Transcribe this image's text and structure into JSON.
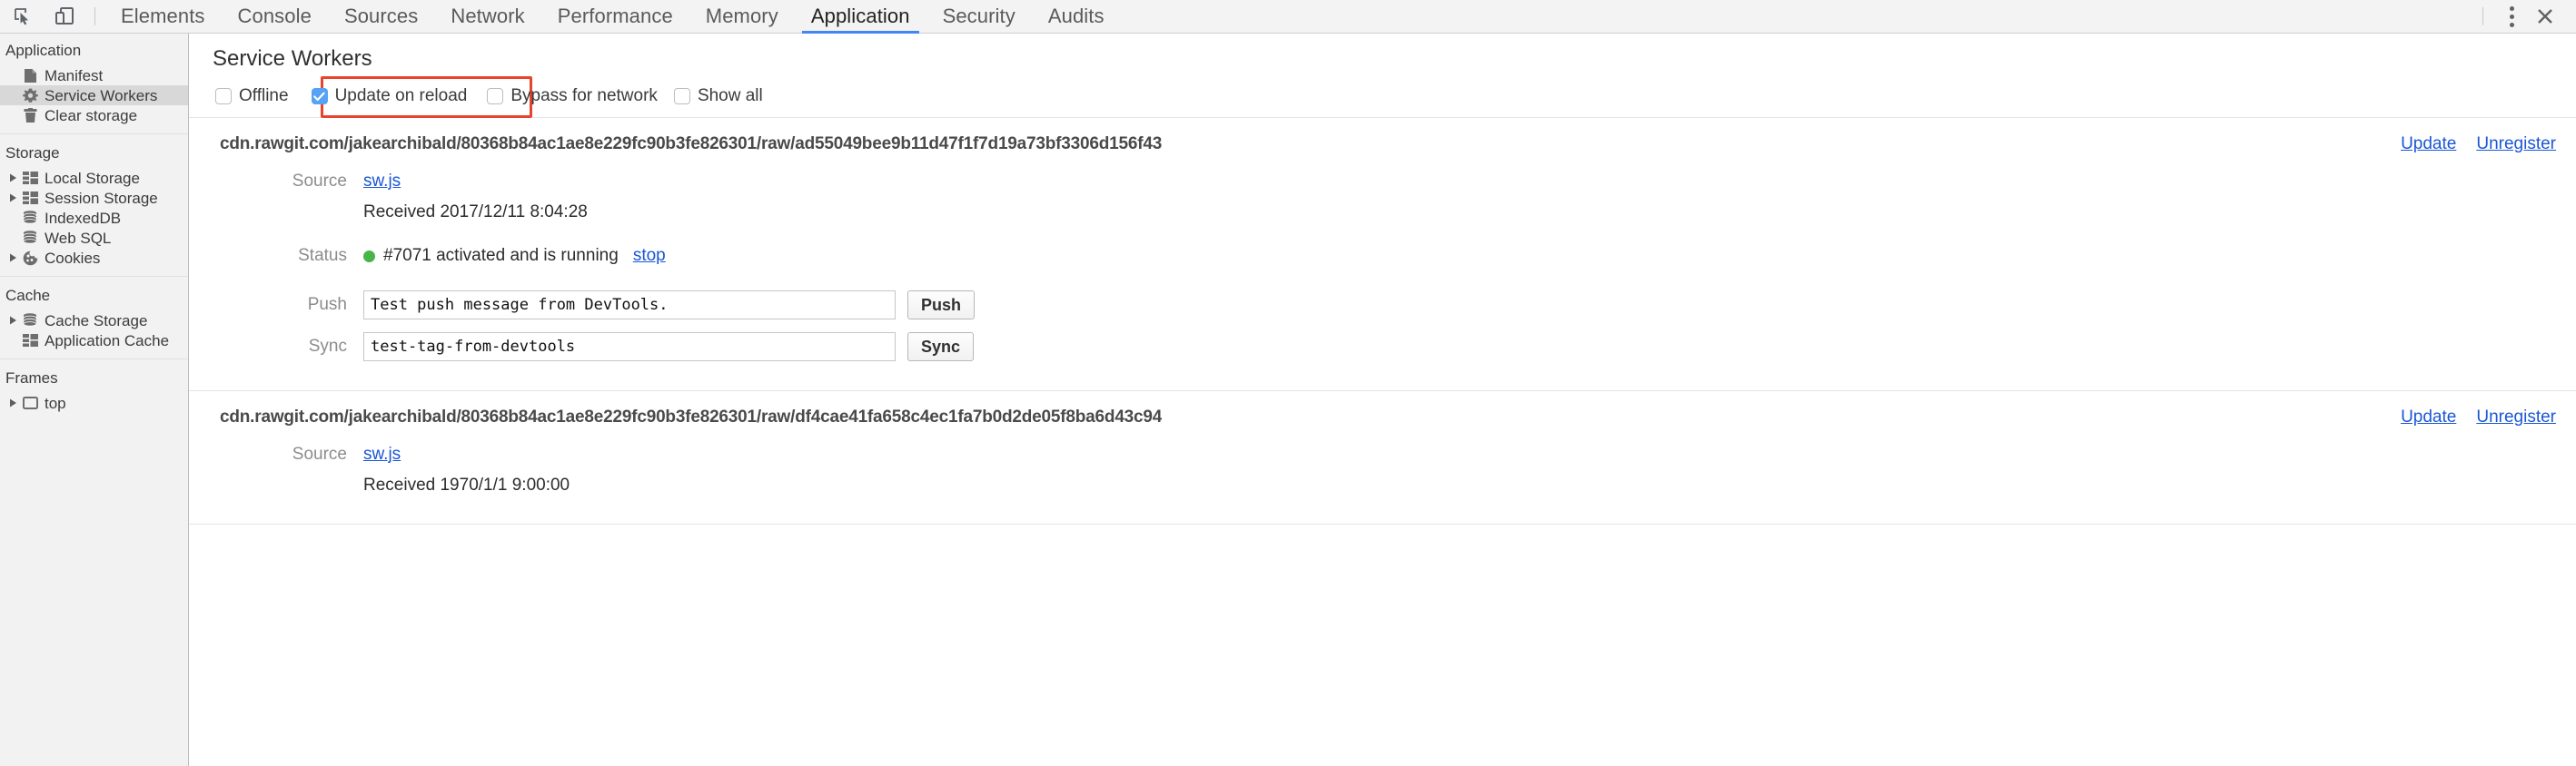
{
  "toolbar": {
    "inspect_icon": "inspect-element-icon",
    "device_icon": "device-toolbar-icon",
    "tabs": [
      {
        "label": "Elements",
        "selected": false
      },
      {
        "label": "Console",
        "selected": false
      },
      {
        "label": "Sources",
        "selected": false
      },
      {
        "label": "Network",
        "selected": false
      },
      {
        "label": "Performance",
        "selected": false
      },
      {
        "label": "Memory",
        "selected": false
      },
      {
        "label": "Application",
        "selected": true
      },
      {
        "label": "Security",
        "selected": false
      },
      {
        "label": "Audits",
        "selected": false
      }
    ],
    "more_icon": "more-vertical-icon",
    "close_icon": "close-icon",
    "accent_color": "#4285f4"
  },
  "sidebar": {
    "groups": [
      {
        "title": "Application",
        "items": [
          {
            "label": "Manifest",
            "icon": "document-icon",
            "expandable": false,
            "selected": false
          },
          {
            "label": "Service Workers",
            "icon": "gear-icon",
            "expandable": false,
            "selected": true
          },
          {
            "label": "Clear storage",
            "icon": "trash-icon",
            "expandable": false,
            "selected": false
          }
        ]
      },
      {
        "title": "Storage",
        "items": [
          {
            "label": "Local Storage",
            "icon": "table-icon",
            "expandable": true,
            "selected": false
          },
          {
            "label": "Session Storage",
            "icon": "table-icon",
            "expandable": true,
            "selected": false
          },
          {
            "label": "IndexedDB",
            "icon": "database-icon",
            "expandable": false,
            "selected": false
          },
          {
            "label": "Web SQL",
            "icon": "database-icon",
            "expandable": false,
            "selected": false
          },
          {
            "label": "Cookies",
            "icon": "cookie-icon",
            "expandable": true,
            "selected": false
          }
        ]
      },
      {
        "title": "Cache",
        "items": [
          {
            "label": "Cache Storage",
            "icon": "database-icon",
            "expandable": true,
            "selected": false
          },
          {
            "label": "Application Cache",
            "icon": "table-icon",
            "expandable": false,
            "selected": false
          }
        ]
      },
      {
        "title": "Frames",
        "items": [
          {
            "label": "top",
            "icon": "frame-icon",
            "expandable": true,
            "selected": false
          }
        ]
      }
    ]
  },
  "panel": {
    "title": "Service Workers",
    "checkboxes": [
      {
        "label": "Offline",
        "checked": false,
        "highlighted": false
      },
      {
        "label": "Update on reload",
        "checked": true,
        "highlighted": true
      },
      {
        "label": "Bypass for network",
        "checked": false,
        "highlighted": false
      },
      {
        "label": "Show all",
        "checked": false,
        "highlighted": false
      }
    ],
    "highlight_color": "#e8432c",
    "checkbox_checked_color": "#54a3f7",
    "link_color": "#1a56d6",
    "status_dot_color": "#49b449",
    "workers": [
      {
        "url": "cdn.rawgit.com/jakearchibald/80368b84ac1ae8e229fc90b3fe826301/raw/ad55049bee9b11d47f1f7d19a73bf3306d156f43",
        "update_label": "Update",
        "unregister_label": "Unregister",
        "source_label": "Source",
        "source_value": "sw.js",
        "received_value": "Received 2017/12/11 8:04:28",
        "status_label": "Status",
        "status_value": "#7071 activated and is running",
        "status_action": "stop",
        "push_label": "Push",
        "push_value": "Test push message from DevTools.",
        "push_button": "Push",
        "sync_label": "Sync",
        "sync_value": "test-tag-from-devtools",
        "sync_button": "Sync",
        "has_detail_rows": true
      },
      {
        "url": "cdn.rawgit.com/jakearchibald/80368b84ac1ae8e229fc90b3fe826301/raw/df4cae41fa658c4ec1fa7b0d2de05f8ba6d43c94",
        "update_label": "Update",
        "unregister_label": "Unregister",
        "source_label": "Source",
        "source_value": "sw.js",
        "received_value": "Received 1970/1/1 9:00:00",
        "has_detail_rows": false
      }
    ]
  }
}
